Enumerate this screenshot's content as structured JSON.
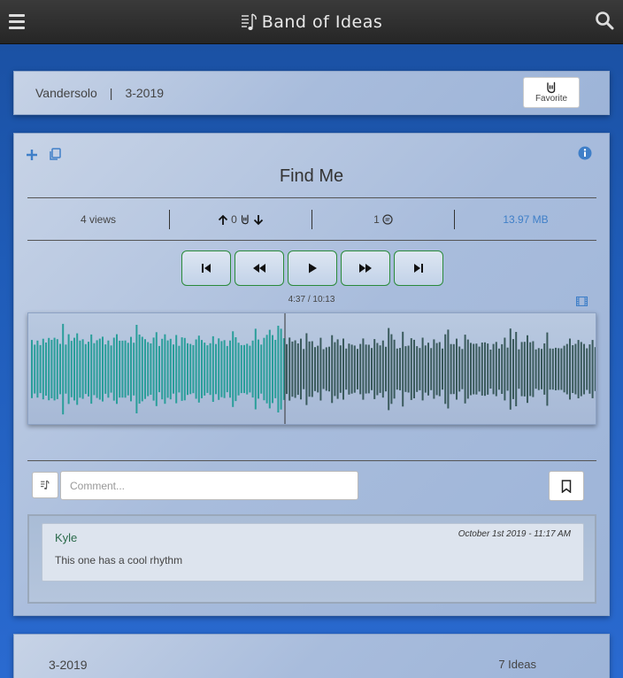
{
  "app": {
    "brand": "Band of Ideas"
  },
  "icons": {
    "menu": "hamburger-menu-icon",
    "search": "search-icon",
    "logo": "music-sheet-icon"
  },
  "header_card": {
    "band": "Vandersolo",
    "separator": "|",
    "date": "3-2019",
    "favorite_label": "Favorite"
  },
  "song": {
    "title": "Find Me",
    "views": "4 views",
    "votes": "0",
    "comments_count": "1",
    "size": "13.97 MB",
    "time": "4:37 / 10:13",
    "progress": 0.451
  },
  "comment_form": {
    "placeholder": "Comment..."
  },
  "comments": [
    {
      "author": "Kyle",
      "date": "October 1st 2019 - 11:17 AM",
      "text": "This one has a cool rhythm"
    }
  ],
  "next_group": {
    "label": "3-2019",
    "count": "7 Ideas"
  },
  "colors": {
    "played": "#2a9e9a",
    "unplayed": "#3a5a5c",
    "accent": "#3f7fc8",
    "control_border": "#2a8a3a"
  }
}
